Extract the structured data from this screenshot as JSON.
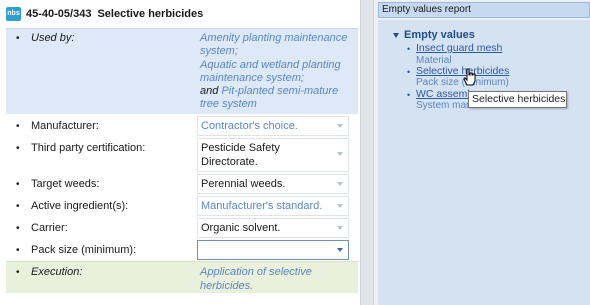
{
  "header": {
    "logo_text": "nbs",
    "clause_code": "45-40-05/343",
    "clause_title": "Selective herbicides"
  },
  "used_by": {
    "label": "Used by:",
    "line1": "Amenity planting maintenance",
    "line2": "system;",
    "line3": "Aquatic and wetland planting",
    "line4": "maintenance system;",
    "and_word": "and",
    "line5": "Pit-planted semi-mature",
    "line6": "tree system"
  },
  "fields": {
    "manufacturer": {
      "label": "Manufacturer:",
      "value": "Contractor's choice."
    },
    "third_party": {
      "label": "Third party certification:",
      "value_line1": "Pesticide Safety",
      "value_line2": "Directorate."
    },
    "target_weeds": {
      "label": "Target weeds:",
      "value": "Perennial weeds."
    },
    "active_ingredient": {
      "label": "Active ingredient(s):",
      "value": "Manufacturer's standard."
    },
    "carrier": {
      "label": "Carrier:",
      "value": "Organic solvent."
    },
    "pack_size": {
      "label": "Pack size (minimum):",
      "value": ""
    }
  },
  "execution": {
    "label": "Execution:",
    "line1": "Application of selective",
    "line2": "herbicides."
  },
  "report": {
    "title": "Empty values report",
    "group": "Empty values",
    "items": [
      {
        "link": "Insect guard mesh",
        "sub": "Material"
      },
      {
        "link": "Selective herbicides",
        "sub": "Pack size (minimum)"
      },
      {
        "link": "WC assemb",
        "sub": "System man"
      }
    ]
  },
  "tooltip": "Selective herbicides",
  "colors": {
    "used_by_bg": "#dde9f7",
    "execution_bg": "#e9f0dc",
    "link": "#2c5aa0",
    "value_blue": "#5b86c2"
  }
}
